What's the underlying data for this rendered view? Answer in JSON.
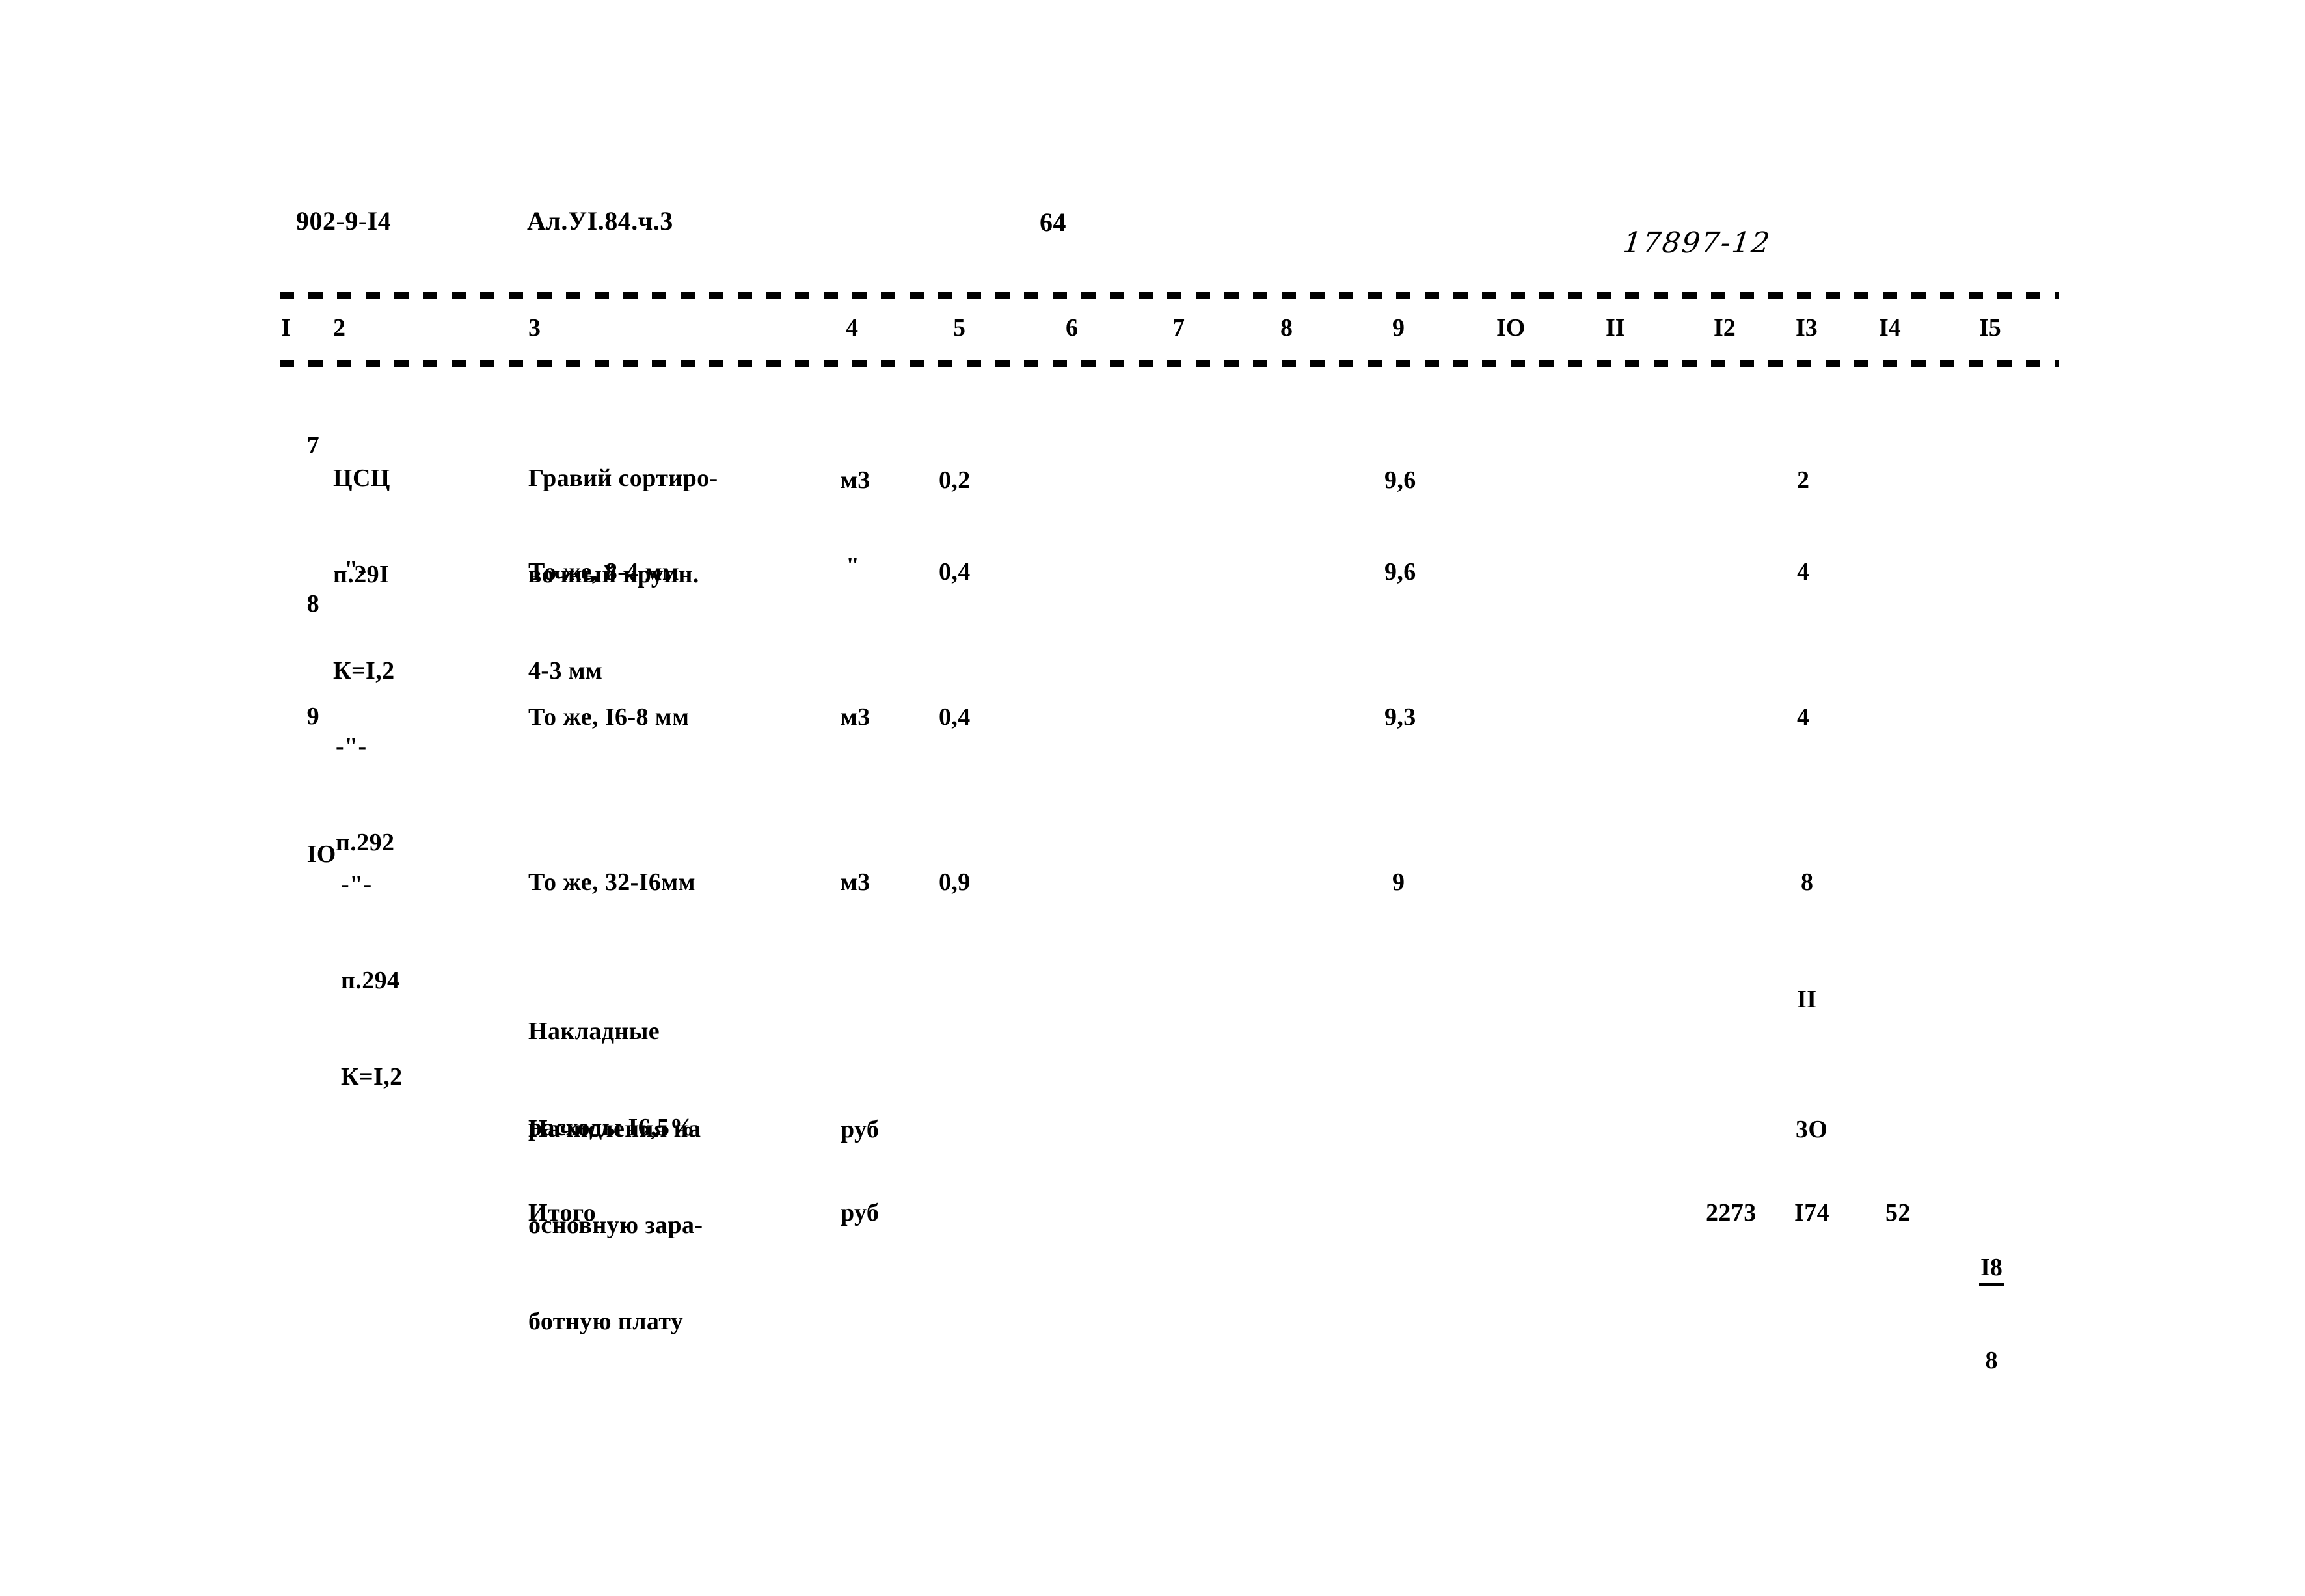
{
  "document": {
    "header": {
      "series_code": "902-9-I4",
      "album": "Ал.УI.84.ч.3",
      "page_number": "64",
      "stamp": "17897-12"
    },
    "column_headers": [
      "I",
      "2",
      "3",
      "4",
      "5",
      "6",
      "7",
      "8",
      "9",
      "IO",
      "II",
      "I2",
      "I3",
      "I4",
      "I5"
    ],
    "rows": [
      {
        "num": "7",
        "ref_line1": "ЦСЦ",
        "ref_line2": "п.29I",
        "ref_line3": "К=I,2",
        "desc_line1": "Гравий сортиро-",
        "desc_line2": "вочный крупн.",
        "desc_line3": "4-3 мм",
        "unit": "м3",
        "qty": "0,2",
        "col9": "9,6",
        "col13": "2"
      },
      {
        "num": "8",
        "ref_line1": "-\"-",
        "ref_line2": "",
        "ref_line3": "",
        "desc_line1": "",
        "desc_line2": "",
        "desc_line3": "То же, 8-4 мм",
        "unit": "\"",
        "qty": "0,4",
        "col9": "9,6",
        "col13": "4"
      },
      {
        "num": "9",
        "ref_line1": "-\"-",
        "ref_line2": "п.292",
        "ref_line3": "",
        "desc_line1": "",
        "desc_line2": "",
        "desc_line3": "То же, I6-8 мм",
        "unit": "м3",
        "qty": "0,4",
        "col9": "9,3",
        "col13": "4"
      },
      {
        "num": "IO",
        "ref_line1": "-\"-",
        "ref_line2": "п.294",
        "ref_line3": "К=I,2",
        "desc_line1": "",
        "desc_line2": "",
        "desc_line3": "То же, 32-I6мм",
        "unit": "м3",
        "qty": "0,9",
        "col9": "9",
        "col13": "8"
      }
    ],
    "summary": [
      {
        "label_line1": "Накладные",
        "label_line2": "расходы I6,5%",
        "label_line3": "",
        "unit": "",
        "col13": "II"
      },
      {
        "label_line1": "Начисления на",
        "label_line2": "основную зара-",
        "label_line3": "ботную плату",
        "unit": "руб",
        "col13": "3O"
      }
    ],
    "total": {
      "label": "Итого",
      "unit": "руб",
      "col12": "2273",
      "col13": "I74",
      "col14": "52",
      "col15_numerator": "I8",
      "col15_denominator": "8"
    }
  }
}
